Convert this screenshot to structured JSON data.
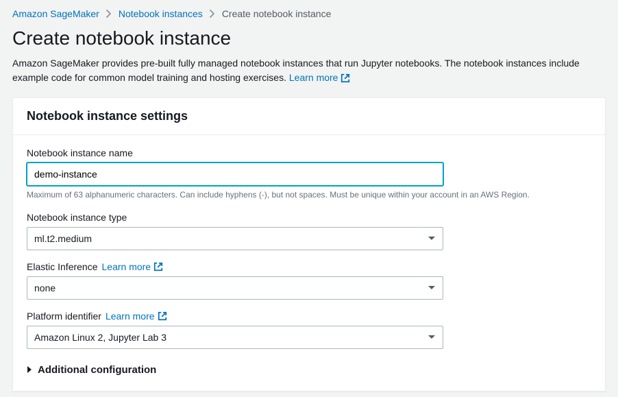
{
  "breadcrumb": {
    "items": [
      {
        "label": "Amazon SageMaker"
      },
      {
        "label": "Notebook instances"
      }
    ],
    "current": "Create notebook instance"
  },
  "page": {
    "title": "Create notebook instance",
    "description_prefix": "Amazon SageMaker provides pre-built fully managed notebook instances that run Jupyter notebooks. The notebook instances include example code for common model training and hosting exercises. ",
    "learn_more": "Learn more"
  },
  "panel": {
    "title": "Notebook instance settings",
    "fields": {
      "name": {
        "label": "Notebook instance name",
        "value": "demo-instance",
        "helper": "Maximum of 63 alphanumeric characters. Can include hyphens (-), but not spaces. Must be unique within your account in an AWS Region."
      },
      "type": {
        "label": "Notebook instance type",
        "value": "ml.t2.medium"
      },
      "elastic": {
        "label": "Elastic Inference",
        "learn_more": "Learn more",
        "value": "none"
      },
      "platform": {
        "label": "Platform identifier",
        "learn_more": "Learn more",
        "value": "Amazon Linux 2, Jupyter Lab 3"
      }
    },
    "additional_config": "Additional configuration"
  }
}
